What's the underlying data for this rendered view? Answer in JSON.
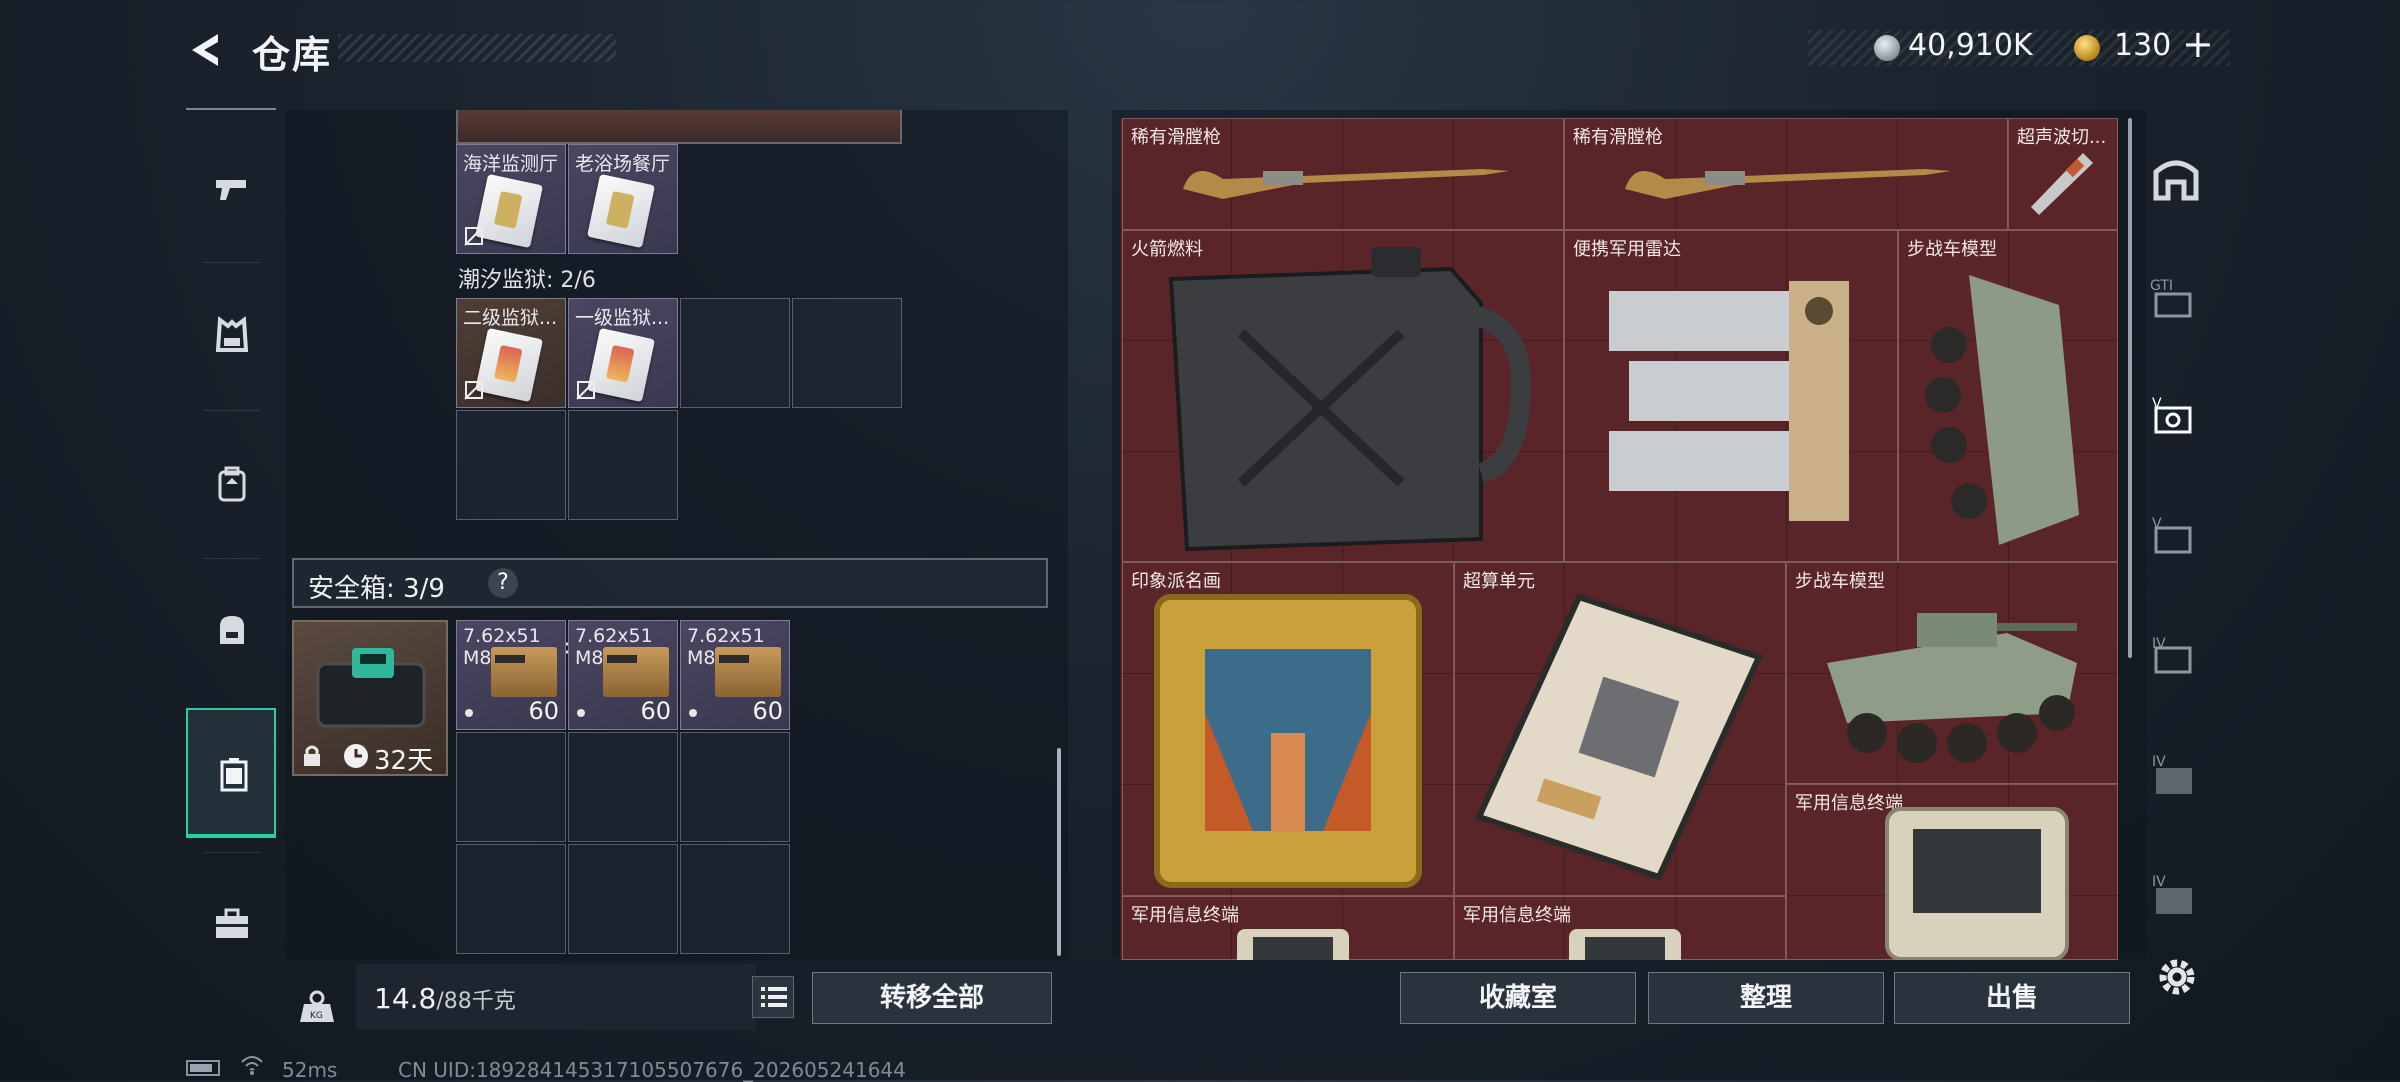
{
  "header": {
    "title": "仓库"
  },
  "currency": {
    "silver": "40,910K",
    "gold": "130",
    "plus": "+"
  },
  "left_panel": {
    "row1": [
      {
        "label": "海洋监测厅"
      },
      {
        "label": "老浴场餐厅"
      }
    ],
    "prison": {
      "label": "潮汐监狱: 2/6"
    },
    "row2": [
      {
        "label": "二级监狱..."
      },
      {
        "label": "一级监狱..."
      }
    ],
    "safebox": {
      "label": "安全箱: 3/9",
      "help": "?",
      "duration": "32天"
    },
    "ammo": [
      {
        "name": "7.62x51",
        "sub": "M80",
        "count": "60"
      },
      {
        "name": "7.62x51",
        "sub": "M80",
        "count": "60"
      },
      {
        "name": "7.62x51",
        "sub": "M80",
        "count": "60"
      }
    ],
    "weight": {
      "value": "14.8",
      "unit": "/88千克"
    },
    "transfer_label": "转移全部"
  },
  "stash": {
    "items": [
      {
        "name": "稀有滑膛枪"
      },
      {
        "name": "稀有滑膛枪"
      },
      {
        "name": "超声波切..."
      },
      {
        "name": "火箭燃料"
      },
      {
        "name": "便携军用雷达"
      },
      {
        "name": "步战车模型"
      },
      {
        "name": "印象派名画"
      },
      {
        "name": "超算单元"
      },
      {
        "name": "步战车模型"
      },
      {
        "name": "军用信息终端"
      },
      {
        "name": "军用信息终端"
      },
      {
        "name": "军用信息终端"
      }
    ],
    "buttons": {
      "collection": "收藏室",
      "sort": "整理",
      "sell": "出售"
    }
  },
  "filters": [
    "house-icon",
    "gti-card-icon",
    "v-card-icon",
    "v-card-icon",
    "iv-card-icon",
    "iv-folder-icon",
    "iv-folder-icon"
  ],
  "footer": {
    "ping": "52ms",
    "uid": "CN UID:18928414531710550767​6_202605241644"
  },
  "colors": {
    "accent": "#26d19a",
    "stash_bg": "#5a2528"
  }
}
